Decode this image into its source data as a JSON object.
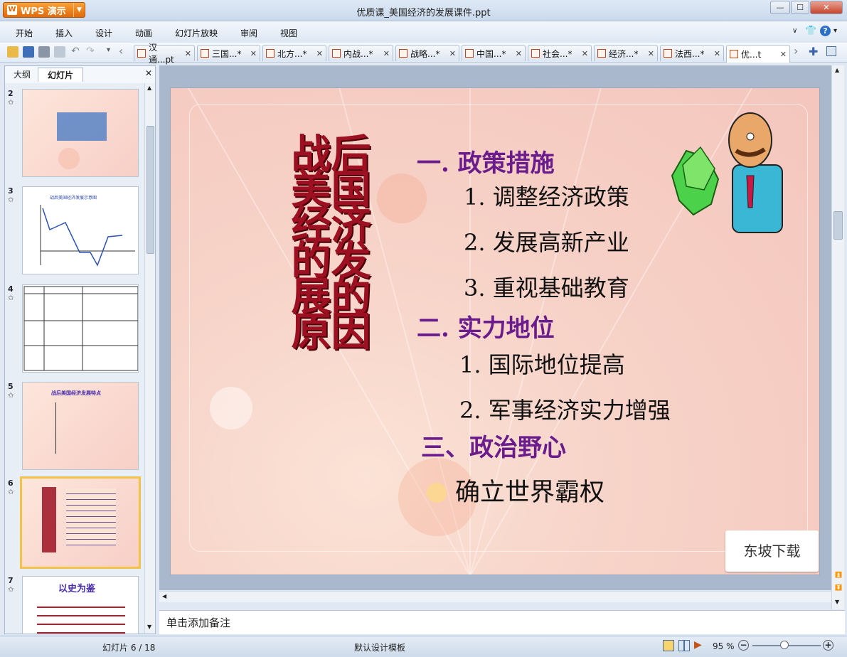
{
  "app": {
    "name": "WPS 演示",
    "window_title": "优质课_美国经济的发展课件.ppt"
  },
  "menu": [
    "开始",
    "插入",
    "设计",
    "动画",
    "幻灯片放映",
    "审阅",
    "视图"
  ],
  "tabs": [
    {
      "label": "汉通...pt",
      "active": false
    },
    {
      "label": "三国...*",
      "active": false
    },
    {
      "label": "北方...*",
      "active": false
    },
    {
      "label": "内战...*",
      "active": false
    },
    {
      "label": "战略...*",
      "active": false
    },
    {
      "label": "中国...*",
      "active": false
    },
    {
      "label": "社会...*",
      "active": false
    },
    {
      "label": "经济...*",
      "active": false
    },
    {
      "label": "法西...*",
      "active": false
    },
    {
      "label": "优...t",
      "active": true
    }
  ],
  "panel": {
    "tab_outline": "大纲",
    "tab_slides": "幻灯片"
  },
  "thumbnails": [
    {
      "num": "2",
      "text": "",
      "selected": false
    },
    {
      "num": "3",
      "text": "战后美国经济发展示意图",
      "selected": false
    },
    {
      "num": "4",
      "text": "",
      "selected": false
    },
    {
      "num": "5",
      "text": "战后美国经济发展特点",
      "selected": false
    },
    {
      "num": "6",
      "text": "",
      "selected": true
    },
    {
      "num": "7",
      "text": "以史为鉴",
      "selected": false
    }
  ],
  "slide": {
    "vertical_title": "战后美国经济的发展的原因",
    "sections": [
      {
        "heading": "一. 政策措施",
        "items": [
          "1. 调整经济政策",
          "2. 发展高新产业",
          "3. 重视基础教育"
        ]
      },
      {
        "heading": "二. 实力地位",
        "items": [
          "1. 国际地位提高",
          "2. 军事经济实力增强"
        ]
      },
      {
        "heading": "三、政治野心",
        "items": [
          "确立世界霸权"
        ]
      }
    ],
    "watermark": "东坡下载"
  },
  "notes_placeholder": "单击添加备注",
  "status": {
    "slide_indicator": "幻灯片 6 / 18",
    "template": "默认设计模板",
    "zoom": "95 %"
  }
}
